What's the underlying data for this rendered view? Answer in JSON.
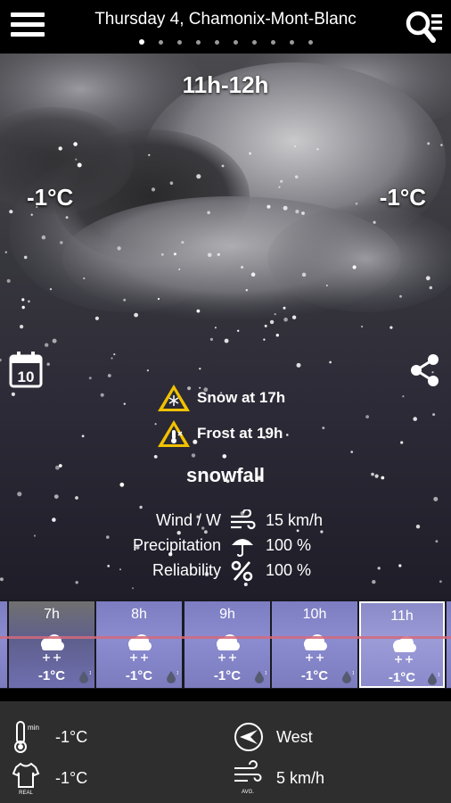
{
  "header": {
    "title": "Thursday 4, Chamonix-Mont-Blanc",
    "page_count": 10,
    "active_page": 1
  },
  "sky": {
    "hour_range": "11h-12h",
    "temp_left": "-1°C",
    "temp_right": "-1°C"
  },
  "calendar": {
    "day": "10"
  },
  "alerts": [
    {
      "text": "Snow at 17h"
    },
    {
      "text": "Frost at 19h"
    }
  ],
  "condition": "snowfall",
  "stats": {
    "wind_label": "Wind / W",
    "wind_value": "15 km/h",
    "precip_label": "Precipitation",
    "precip_value": "100 %",
    "reliability_label": "Reliability",
    "reliability_value": "100 %"
  },
  "hourly": [
    {
      "hour": "7h",
      "temp": "-1°C"
    },
    {
      "hour": "8h",
      "temp": "-1°C"
    },
    {
      "hour": "9h",
      "temp": "-1°C"
    },
    {
      "hour": "10h",
      "temp": "-1°C"
    },
    {
      "hour": "11h",
      "temp": "-1°C"
    }
  ],
  "bottom": {
    "min_temp": "-1°C",
    "min_caption": "min",
    "real_temp": "-1°C",
    "real_caption": "REAL",
    "wind_direction": "West",
    "avg_wind": "5 km/h",
    "avg_caption": "AVG."
  },
  "colors": {
    "hour_cell": "#8787cc",
    "alert_yellow": "#f2c200",
    "temp_line": "#d46a7a"
  }
}
